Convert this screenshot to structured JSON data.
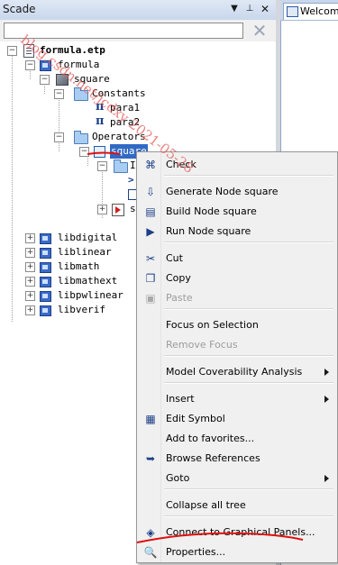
{
  "panel": {
    "title": "Scade",
    "dropdown_icon": "dropdown-arrow-icon",
    "pin_icon": "pin-icon",
    "close_icon": "close-icon"
  },
  "search": {
    "value": "",
    "placeholder": ""
  },
  "welcome_tab": {
    "label": "Welcome"
  },
  "tree": {
    "root": "formula.etp",
    "formula": "formula",
    "square_pkg": "square",
    "constants": "Constants",
    "para1": "para1",
    "para2": "para2",
    "operators": "Operators",
    "square_op": "square",
    "child1": "I",
    "child2": "s",
    "libs": [
      "libdigital",
      "liblinear",
      "libmath",
      "libmathext",
      "libpwlinear",
      "libverif"
    ]
  },
  "watermark": {
    "text": "blog.csdn.net/jcdxy 2021-05-28"
  },
  "menu": {
    "items": [
      {
        "label": "Check",
        "icon": "check-icon",
        "disabled": false,
        "submenu": false
      },
      {
        "label": "Generate Node square",
        "icon": "generate-icon",
        "disabled": false,
        "submenu": false
      },
      {
        "label": "Build Node square",
        "icon": "build-icon",
        "disabled": false,
        "submenu": false
      },
      {
        "label": "Run Node square",
        "icon": "run-icon",
        "disabled": false,
        "submenu": false
      },
      {
        "label": "Cut",
        "icon": "cut-icon",
        "disabled": false,
        "submenu": false
      },
      {
        "label": "Copy",
        "icon": "copy-icon",
        "disabled": false,
        "submenu": false
      },
      {
        "label": "Paste",
        "icon": "paste-icon",
        "disabled": true,
        "submenu": false
      },
      {
        "label": "Focus on Selection",
        "icon": "",
        "disabled": false,
        "submenu": false
      },
      {
        "label": "Remove Focus",
        "icon": "",
        "disabled": true,
        "submenu": false
      },
      {
        "label": "Model Coverability Analysis",
        "icon": "",
        "disabled": false,
        "submenu": true
      },
      {
        "label": "Insert",
        "icon": "",
        "disabled": false,
        "submenu": true
      },
      {
        "label": "Edit Symbol",
        "icon": "edit-symbol-icon",
        "disabled": false,
        "submenu": false
      },
      {
        "label": "Add to favorites...",
        "icon": "",
        "disabled": false,
        "submenu": false
      },
      {
        "label": "Browse References",
        "icon": "browse-references-icon",
        "disabled": false,
        "submenu": false
      },
      {
        "label": "Goto",
        "icon": "",
        "disabled": false,
        "submenu": true
      },
      {
        "label": "Collapse all tree",
        "icon": "",
        "disabled": false,
        "submenu": false
      },
      {
        "label": "Connect to Graphical Panels...",
        "icon": "graphical-panels-icon",
        "disabled": false,
        "submenu": false
      },
      {
        "label": "Properties...",
        "icon": "properties-icon",
        "disabled": false,
        "submenu": false
      }
    ]
  }
}
